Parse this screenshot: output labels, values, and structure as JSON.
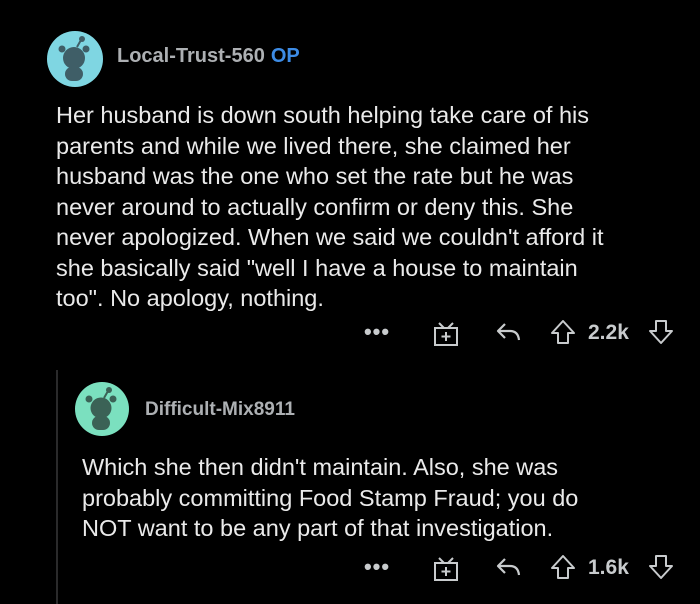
{
  "colors": {
    "background": "#000000",
    "avatar_bg_1": "#7fd6e2",
    "avatar_bg_2": "#7be0bf",
    "op_badge": "#3d8ce6",
    "text": "#eaeaea",
    "muted": "#adb0b3"
  },
  "comments": [
    {
      "username": "Local-Trust-560",
      "op_badge": "OP",
      "body": "Her husband is down south helping take care of his\nparents and while we lived there, she claimed her\nhusband was the one who set the rate but he was\nnever around to actually confirm or deny this. She\nnever apologized. When we said we couldn't afford it\nshe basically said \"well I have a house to maintain\ntoo\". No apology, nothing.",
      "more_label": "•••",
      "score": "2.2k",
      "icons": [
        "more-icon",
        "gift-icon",
        "reply-icon",
        "upvote-icon",
        "downvote-icon"
      ]
    },
    {
      "username": "Difficult-Mix8911",
      "body": "Which she then didn't maintain. Also, she was\nprobably committing Food Stamp Fraud; you do\nNOT want to be any part of that investigation.",
      "more_label": "•••",
      "score": "1.6k",
      "icons": [
        "more-icon",
        "gift-icon",
        "reply-icon",
        "upvote-icon",
        "downvote-icon"
      ]
    }
  ]
}
